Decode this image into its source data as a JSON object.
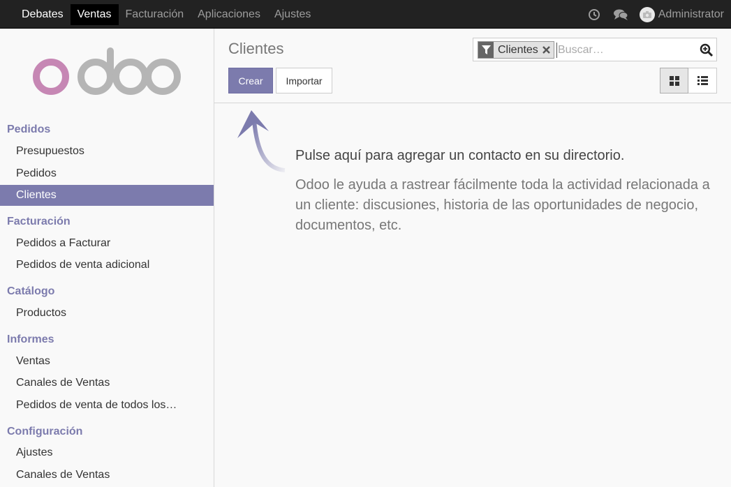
{
  "topbar": {
    "menu": [
      {
        "label": "Debates"
      },
      {
        "label": "Ventas"
      },
      {
        "label": "Facturación"
      },
      {
        "label": "Aplicaciones"
      },
      {
        "label": "Ajustes"
      }
    ],
    "user_name": "Administrator"
  },
  "sidebar": {
    "logo_text": "odoo",
    "sections": [
      {
        "title": "Pedidos",
        "items": [
          "Presupuestos",
          "Pedidos",
          "Clientes"
        ]
      },
      {
        "title": "Facturación",
        "items": [
          "Pedidos a Facturar",
          "Pedidos de venta adicional"
        ]
      },
      {
        "title": "Catálogo",
        "items": [
          "Productos"
        ]
      },
      {
        "title": "Informes",
        "items": [
          "Ventas",
          "Canales de Ventas",
          "Pedidos de venta de todos los…"
        ]
      },
      {
        "title": "Configuración",
        "items": [
          "Ajustes",
          "Canales de Ventas"
        ]
      }
    ],
    "active_item": "Clientes"
  },
  "control": {
    "title": "Clientes",
    "create_label": "Crear",
    "import_label": "Importar",
    "search": {
      "facet_label": "Clientes",
      "placeholder": "Buscar…"
    }
  },
  "help": {
    "title": "Pulse aquí para agregar un contacto en su directorio.",
    "text": "Odoo le ayuda a rastrear fácilmente toda la actividad relacionada a un cliente: discusiones, historia de las oportunidades de negocio, documentos, etc."
  },
  "colors": {
    "brand": "#7c7bad",
    "topbar": "#222222",
    "logo_o": "#c687b4",
    "logo_doo": "#b5b5b5"
  },
  "icons": {
    "history": "clock-icon",
    "chat": "comments-icon",
    "avatar": "camera-icon",
    "facet": "filter-icon",
    "remove": "close-icon",
    "search": "search-icon",
    "kanban": "kanban-view-icon",
    "list": "list-view-icon"
  }
}
